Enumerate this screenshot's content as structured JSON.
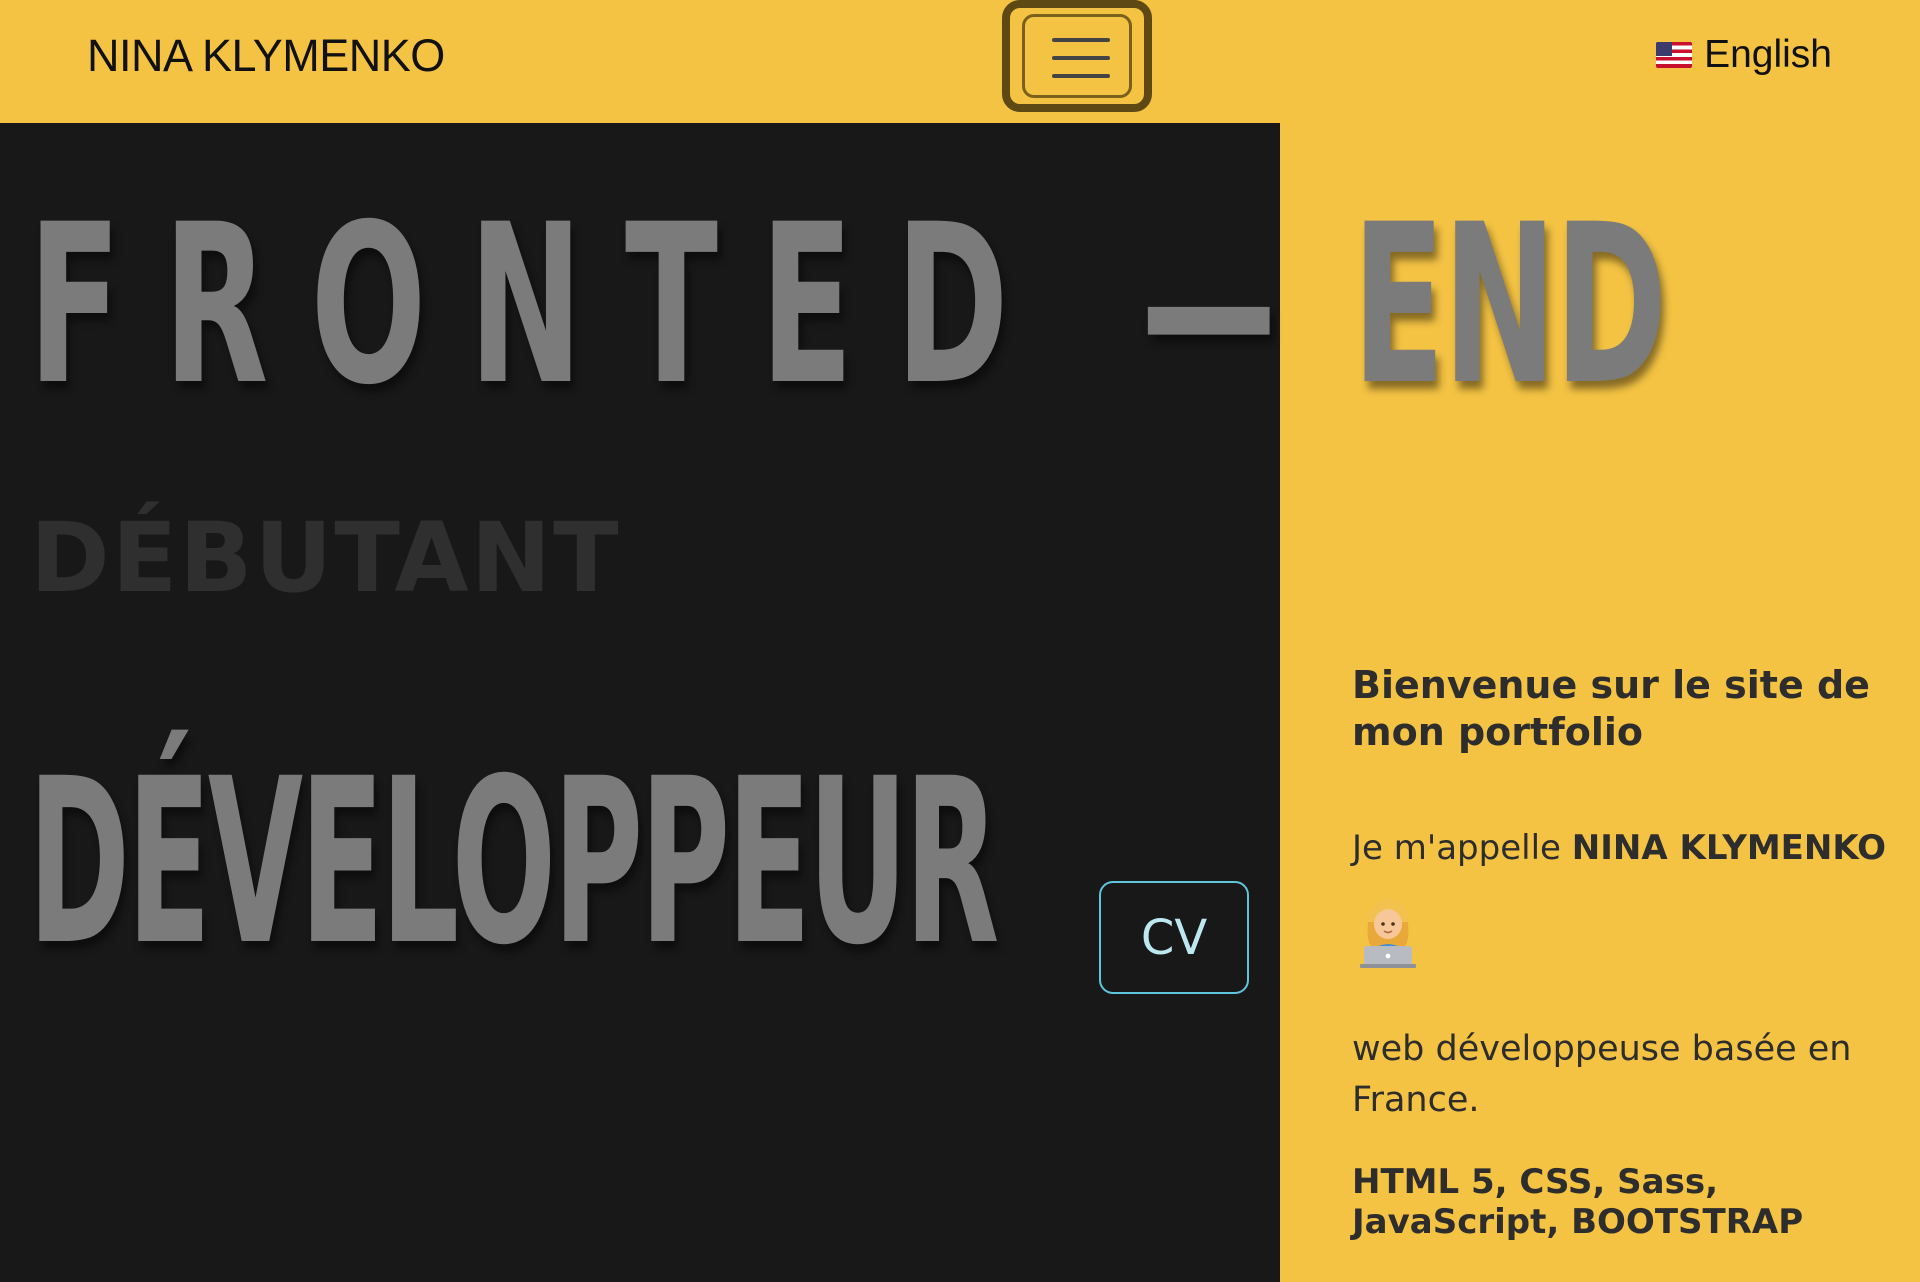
{
  "navbar": {
    "brand": "NINA KLYMENKO",
    "toggler_icon": "hamburger-icon",
    "language": {
      "flag_icon": "us-flag-icon",
      "label": "English"
    }
  },
  "hero": {
    "line1_left": "FRONTED —",
    "line1_right": "END",
    "subtitle": "DÉBUTANT",
    "line2": "DÉVELOPPEUR",
    "cv_label": "CV"
  },
  "intro": {
    "welcome": "Bienvenue sur le site de mon portfolio",
    "name_prefix": "Je m'appelle ",
    "name": "NINA KLYMENKO",
    "emoji_icon": "woman-technologist-icon",
    "description": "web développeuse basée en France.",
    "skills": "HTML 5, CSS, Sass, JavaScript, BOOTSTRAP"
  },
  "colors": {
    "accent_yellow": "#f4c343",
    "dark_panel": "#181818",
    "hero_text": "#7b7b7b",
    "cv_border": "#5fc5dd"
  }
}
